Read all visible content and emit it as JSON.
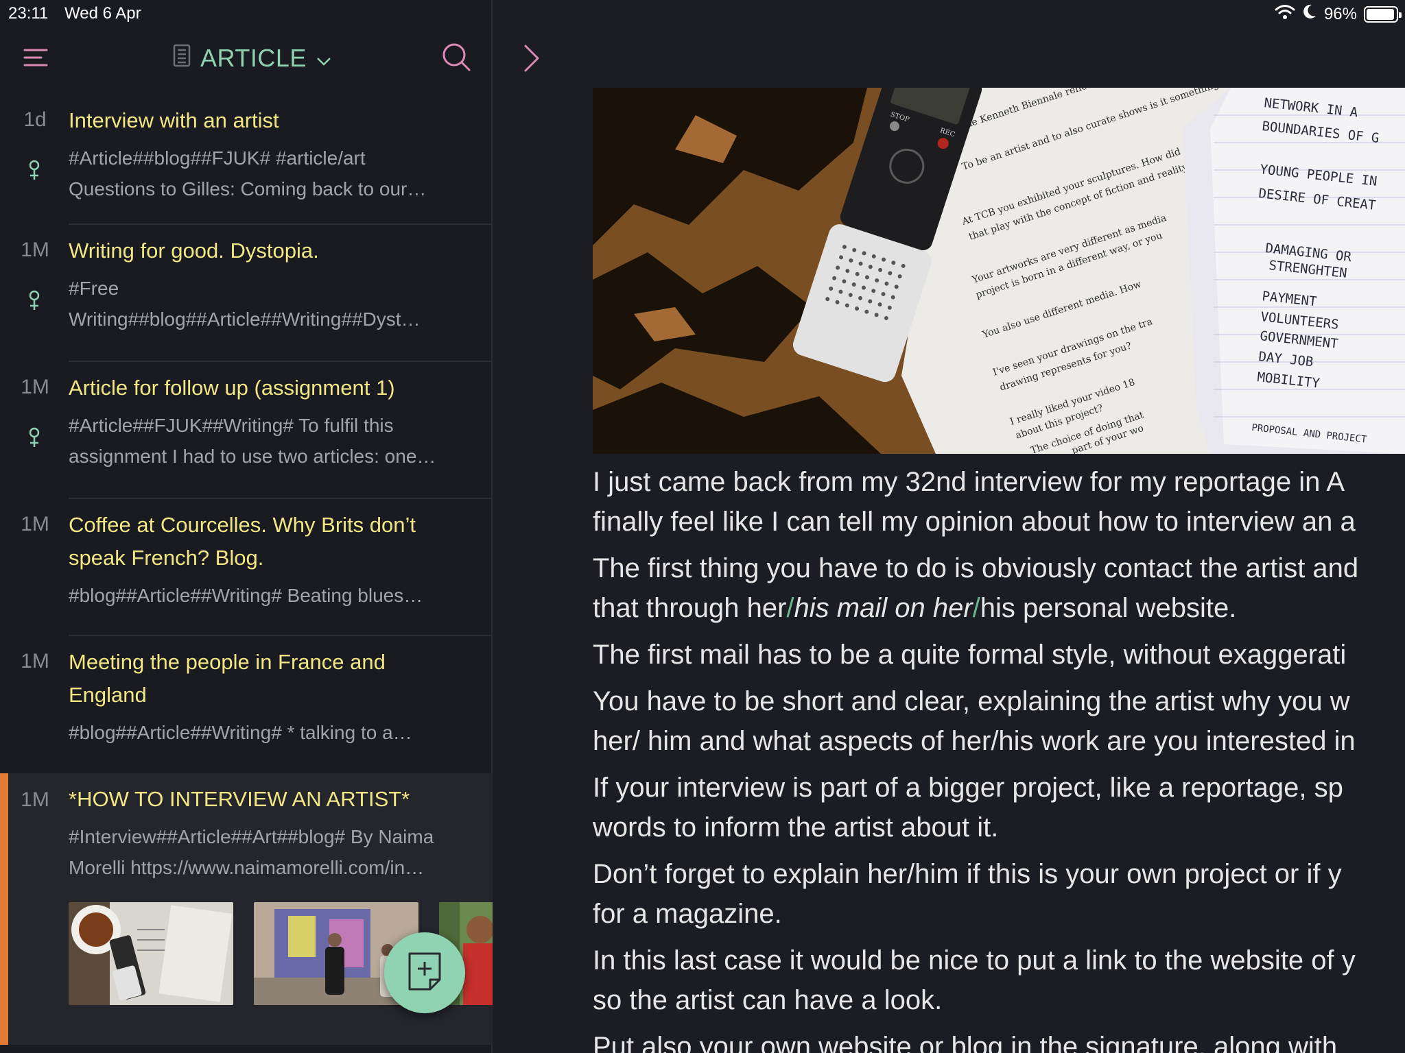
{
  "status_bar": {
    "time": "23:11",
    "date": "Wed 6 Apr",
    "battery": "96%",
    "battery_level": 0.96
  },
  "sidebar": {
    "notebook_title": "ARTICLE",
    "menu_icon": "hamburger-menu-icon",
    "search_icon": "search-icon",
    "notes": [
      {
        "age": "1d",
        "title": "Interview with an artist",
        "snippet_1": "#Article##blog##FJUK# #article/art",
        "snippet_2": "Questions to Gilles: Coming back to our…",
        "pinned": true
      },
      {
        "age": "1M",
        "title": "Writing for good. Dystopia.",
        "snippet_1": "#Free",
        "snippet_2": "Writing##blog##Article##Writing##Dyst…",
        "pinned": true
      },
      {
        "age": "1M",
        "title": "Article for follow up (assignment 1)",
        "snippet_1": "#Article##FJUK##Writing# To fulfil this",
        "snippet_2": "assignment I had to use two articles: one…",
        "pinned": true
      },
      {
        "age": "1M",
        "title_1": "Coffee at Courcelles. Why Brits don’t",
        "title_2": "speak French? Blog.",
        "snippet_1": "#blog##Article##Writing# Beating blues…",
        "pinned": false
      },
      {
        "age": "1M",
        "title_1": "Meeting the people in France and",
        "title_2": "England",
        "snippet_1": "#blog##Article##Writing# * talking to a…",
        "pinned": false
      },
      {
        "age": "1M",
        "title": "*HOW TO INTERVIEW AN ARTIST*",
        "snippet_1": "#Interview##Article##Art##blog# By Naima",
        "snippet_2": "Morelli https://www.naimamorelli.com/in…",
        "pinned": false,
        "selected": true
      }
    ],
    "fab_icon": "new-note-icon"
  },
  "content": {
    "expand_icon": "chevron-right-icon",
    "paragraphs": {
      "p1_l1": "I just came back from my 32nd interview for my reportage in A",
      "p1_l2": "finally feel like I can tell my opinion about how to interview an a",
      "p2_l1": "The first thing you have to do is obviously contact the artist and",
      "p2_l2_a": "that through her",
      "p2_l2_b": "his mail on her",
      "p2_l2_c": "his personal website.",
      "p3_l1": "The first mail has to be a quite formal style, without exaggerati",
      "p4_l1": "You have to be short and clear, explaining the artist why you w",
      "p4_l2": "her/ him and what aspects of her/his work are you interested in",
      "p5_l1": "If your interview is part of a bigger project, like a reportage, sp",
      "p5_l2": "words to inform the artist about it.",
      "p6_l1": "Don’t forget to explain her/him if this is your own project or if y",
      "p6_l2": "for a magazine.",
      "p7_l1": "In this last case it would be nice to put a link to the website of y",
      "p7_l2": "so the artist can have a look.",
      "p8_l1": "Put also your own website or blog in the signature, along with"
    },
    "image_text": {
      "q1": "the Kenneth Biennale reflect you",
      "q2": "To be an artist and to also curate shows is it something",
      "q3": "At TCB you exhibited your sculptures. How did",
      "q4": "that play with the concept of fiction and reality",
      "q5": "Your artworks are very different as media",
      "q6": "project is born in a different way, or you",
      "q7": "You also use different media. How",
      "q8": "I've seen your drawings on the tra",
      "q9": "drawing represents for you?",
      "q10": "I really liked your video 18",
      "q11": "about this project?",
      "q12": "The choice of doing that",
      "q13": "part of your wo",
      "n1": "NETWORK IN A",
      "n2": "BOUNDARIES OF G",
      "n3": "YOUNG PEOPLE IN",
      "n4": "DESIRE OF CREAT",
      "n5": "DAMAGING OR",
      "n6": "STRENGHTEN",
      "n7": "PAYMENT",
      "n8": "VOLUNTEERS",
      "n9": "GOVERNMENT",
      "n10": "DAY JOB",
      "n11": "MOBILITY",
      "n12": "PROPOSAL AND PROJECT",
      "rec_stop": "STOP",
      "rec_rec": "REC"
    }
  }
}
